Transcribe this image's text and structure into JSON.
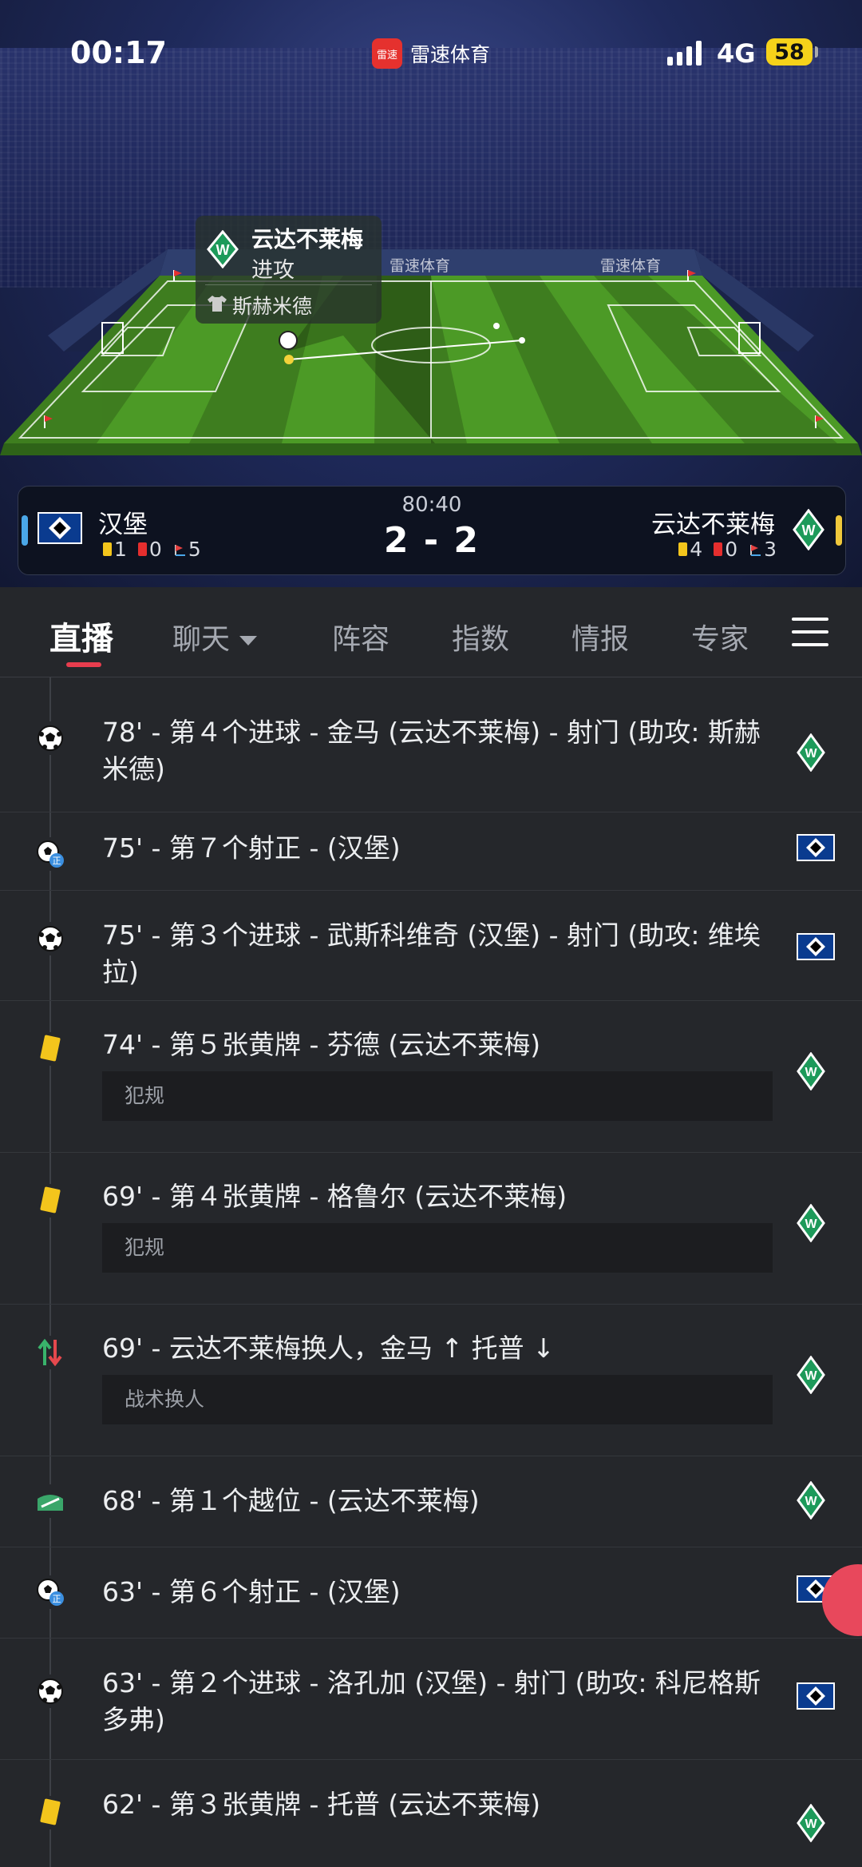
{
  "status_bar": {
    "time": "00:17",
    "app_name": "雷速体育",
    "app_logo_text": "雷速",
    "network": "4G",
    "battery": "58"
  },
  "pitch": {
    "ad_text": "雷速体育",
    "event_popup": {
      "team": "云达不莱梅",
      "action": "进攻",
      "player": "斯赫米德"
    }
  },
  "scoreboard": {
    "clock": "80:40",
    "score": "2 - 2",
    "home": {
      "name": "汉堡",
      "yellow": "1",
      "red": "0",
      "corners": "5"
    },
    "away": {
      "name": "云达不莱梅",
      "yellow": "4",
      "red": "0",
      "corners": "3"
    }
  },
  "tabs": [
    {
      "label": "直播",
      "active": true
    },
    {
      "label": "聊天",
      "active": false
    },
    {
      "label": "阵容",
      "active": false
    },
    {
      "label": "指数",
      "active": false
    },
    {
      "label": "情报",
      "active": false
    },
    {
      "label": "专家",
      "active": false
    }
  ],
  "events": [
    {
      "icon": "goal-icon",
      "text": "78' - 第４个进球 - 金马 (云达不莱梅) - 射门 (助攻: 斯赫米德)",
      "reason": "",
      "team": "away"
    },
    {
      "icon": "shot-on-target-icon",
      "text": "75' - 第７个射正 - (汉堡)",
      "reason": "",
      "team": "home"
    },
    {
      "icon": "goal-icon",
      "text": "75' - 第３个进球 - 武斯科维奇 (汉堡) - 射门 (助攻: 维埃拉)",
      "reason": "",
      "team": "home"
    },
    {
      "icon": "yellow-card-icon",
      "text": "74' - 第５张黄牌 - 芬德 (云达不莱梅)",
      "reason": "犯规",
      "team": "away"
    },
    {
      "icon": "yellow-card-icon",
      "text": "69' - 第４张黄牌 - 格鲁尔 (云达不莱梅)",
      "reason": "犯规",
      "team": "away"
    },
    {
      "icon": "substitution-icon",
      "text": "69' - 云达不莱梅换人，金马 ↑ 托普 ↓",
      "reason": "战术换人",
      "team": "away"
    },
    {
      "icon": "offside-icon",
      "text": "68' - 第１个越位 - (云达不莱梅)",
      "reason": "",
      "team": "away"
    },
    {
      "icon": "shot-on-target-icon",
      "text": "63' - 第６个射正 - (汉堡)",
      "reason": "",
      "team": "home"
    },
    {
      "icon": "goal-icon",
      "text": "63' - 第２个进球 - 洛孔加 (汉堡) - 射门 (助攻: 科尼格斯多弗)",
      "reason": "",
      "team": "home"
    },
    {
      "icon": "yellow-card-icon",
      "text": "62' - 第３张黄牌 - 托普 (云达不莱梅)",
      "reason": "",
      "team": "away"
    }
  ],
  "colors": {
    "accent": "#e83d4e",
    "pitch_green": "#4c9a26",
    "werder_green": "#1d9a5a",
    "hsv_blue": "#0a3b8f"
  }
}
